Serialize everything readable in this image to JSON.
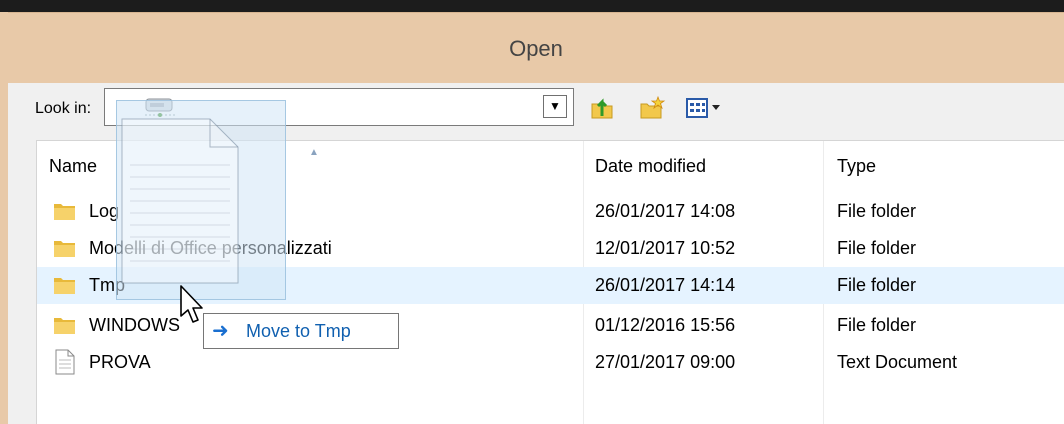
{
  "window": {
    "title": "Open"
  },
  "toolbar": {
    "look_in_label": "Look in:",
    "combo_arrow": "▼",
    "buttons": [
      {
        "name": "up-folder-button",
        "icon": "up-folder-icon"
      },
      {
        "name": "new-folder-button",
        "icon": "new-folder-icon"
      },
      {
        "name": "view-menu-button",
        "icon": "view-menu-icon"
      }
    ]
  },
  "list": {
    "columns": [
      "Name",
      "Date modified",
      "Type"
    ],
    "rows": [
      {
        "name": "Log",
        "date": "26/01/2017 14:08",
        "type": "File folder",
        "icon": "folder-icon"
      },
      {
        "name": "Modelli di Office personalizzati",
        "date": "12/01/2017 10:52",
        "type": "File folder",
        "icon": "folder-icon"
      },
      {
        "name": "Tmp",
        "date": "26/01/2017 14:14",
        "type": "File folder",
        "icon": "folder-icon",
        "selected": true
      },
      {
        "name": "WINDOWS",
        "date": "01/12/2016 15:56",
        "type": "File folder",
        "icon": "folder-icon"
      },
      {
        "name": "PROVA",
        "date": "27/01/2017 09:00",
        "type": "Text Document",
        "icon": "text-document-icon"
      }
    ]
  },
  "drag": {
    "tooltip": "Move to Tmp",
    "tooltip_icon": "arrow-right-icon"
  },
  "colors": {
    "titlebar": "#e8c9a8",
    "selection": "#e5f3ff",
    "tooltip_text": "#1060b0"
  }
}
